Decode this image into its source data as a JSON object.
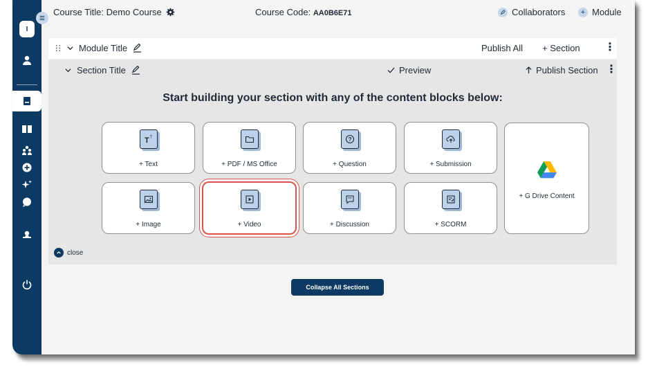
{
  "header": {
    "course_title": "Course Title: Demo Course",
    "course_code_label": "Course Code:",
    "course_code_value": "AA0B6E71",
    "collaborators": "Collaborators",
    "module": "Module"
  },
  "sidebar": {
    "logo_text": "I",
    "items": [
      "user-icon",
      "book-icon",
      "reader-icon",
      "users-icon",
      "add-circle-icon",
      "sparkle-icon",
      "chat-icon",
      "certificate-icon",
      "power-icon"
    ]
  },
  "module_bar": {
    "title": "Module Title",
    "publish_all": "Publish All",
    "add_section": "+ Section"
  },
  "section": {
    "title": "Section Title",
    "preview": "Preview",
    "publish_section": "Publish Section",
    "headline": "Start building your section with any of the content blocks below:",
    "close": "close"
  },
  "blocks": {
    "text": "+ Text",
    "pdf": "+ PDF / MS Office",
    "question": "+ Question",
    "submission": "+ Submission",
    "gdrive": "+ G Drive Content",
    "image": "+ Image",
    "video": "+ Video",
    "discussion": "+ Discussion",
    "scorm": "+ SCORM"
  },
  "footer": {
    "collapse_all": "Collapse All Sections"
  },
  "colors": {
    "sidebar": "#0c3a63",
    "accent_light": "#c7d7ea",
    "highlight": "#d9534f"
  }
}
